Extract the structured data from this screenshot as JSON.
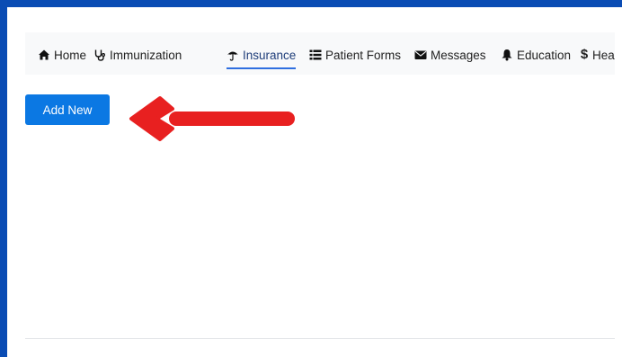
{
  "nav": {
    "items": [
      {
        "label": "Home",
        "icon": "home-icon"
      },
      {
        "label": "Immunization",
        "icon": "stethoscope-icon"
      },
      {
        "label": "Insurance",
        "icon": "umbrella-icon",
        "active": true
      },
      {
        "label": "Patient Forms",
        "icon": "list-icon"
      },
      {
        "label": "Messages",
        "icon": "envelope-icon"
      },
      {
        "label": "Education",
        "icon": "bell-icon"
      },
      {
        "label": "Hea",
        "icon": "dollar-icon"
      }
    ]
  },
  "actions": {
    "add_new_label": "Add New"
  },
  "annotation": {
    "arrow_color": "#e82020"
  },
  "colors": {
    "accent": "#0b78e3",
    "border": "#0a4cb4"
  }
}
